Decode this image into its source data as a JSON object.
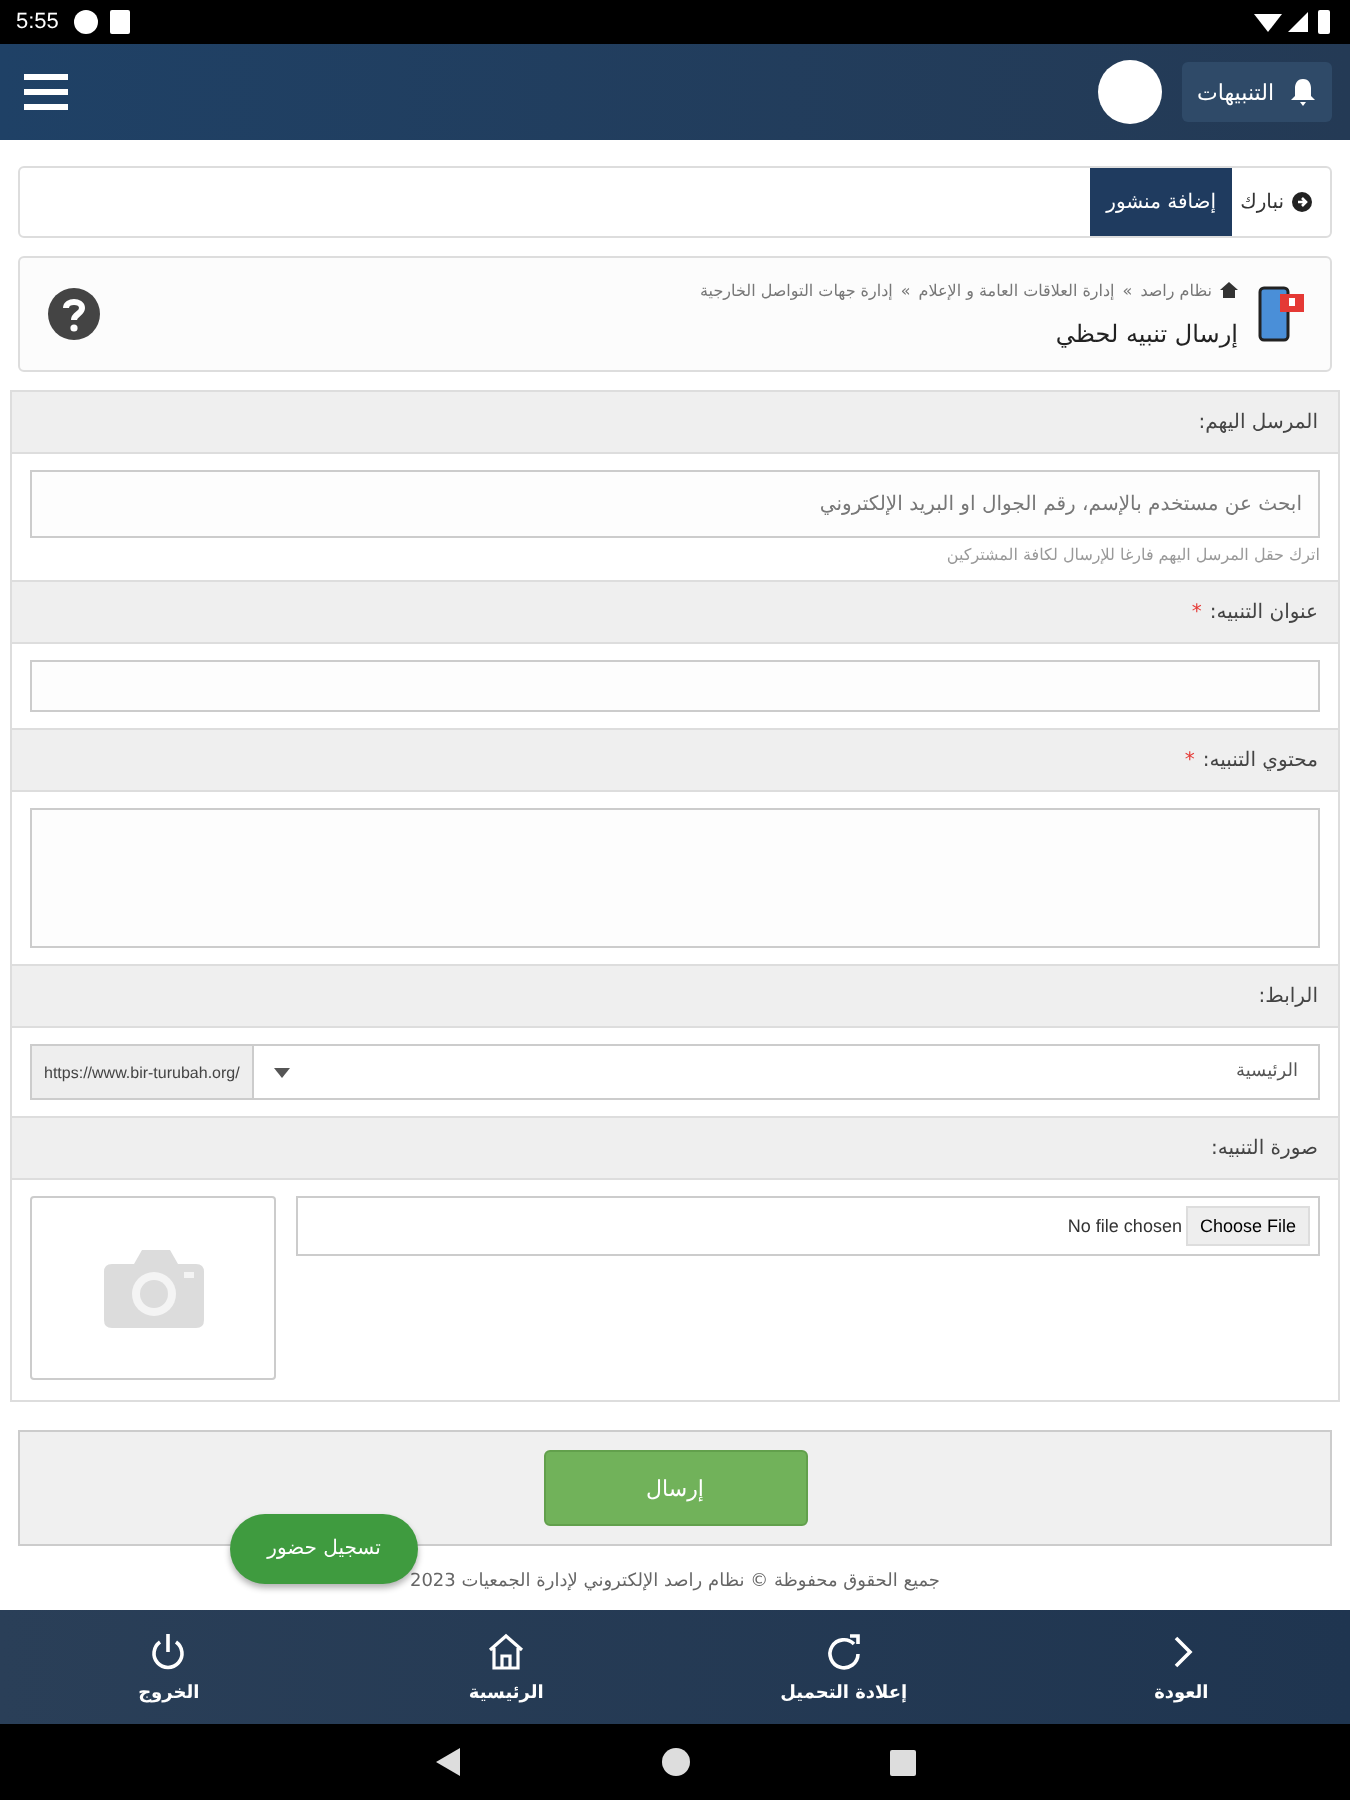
{
  "status_bar": {
    "time": "5:55"
  },
  "header": {
    "notifications_label": "التنبيهات"
  },
  "announcement": {
    "text": "نبارك",
    "button": "إضافة منشور"
  },
  "page": {
    "separator": "»",
    "breadcrumb": [
      "نظام راصد",
      "إدارة العلاقات العامة و الإعلام",
      "إدارة جهات التواصل الخارجية"
    ],
    "title": "إرسال تنبيه لحظي"
  },
  "form": [
    {
      "kind": "search",
      "label": "المرسل اليهم:",
      "placeholder": "ابحث عن مستخدم بالإسم، رقم الجوال او البريد الإلكتروني",
      "hint": "اترك حقل المرسل اليهم فارغا للإرسال لكافة المشتركين"
    },
    {
      "kind": "text",
      "label": "عنوان التنبيه:",
      "required_mark": "*"
    },
    {
      "kind": "textarea",
      "label": "محتوي التنبيه:",
      "required_mark": "*"
    },
    {
      "kind": "link",
      "label": "الرابط:",
      "value": "الرئيسية",
      "prefix": "https://www.bir-turubah.org/"
    },
    {
      "kind": "image",
      "label": "صورة التنبيه:",
      "file_button": "Choose File",
      "file_status": "No file chosen"
    }
  ],
  "submit_button": "إرسال",
  "attendance_button": "تسجيل حضور",
  "footer": "جميع الحقوق محفوظة © نظام راصد الإلكتروني لإدارة الجمعيات 2023",
  "bottom_nav": [
    {
      "label": "العودة"
    },
    {
      "label": "إعلادة التحميل"
    },
    {
      "label": "الرئيسية"
    },
    {
      "label": "الخروج"
    }
  ]
}
